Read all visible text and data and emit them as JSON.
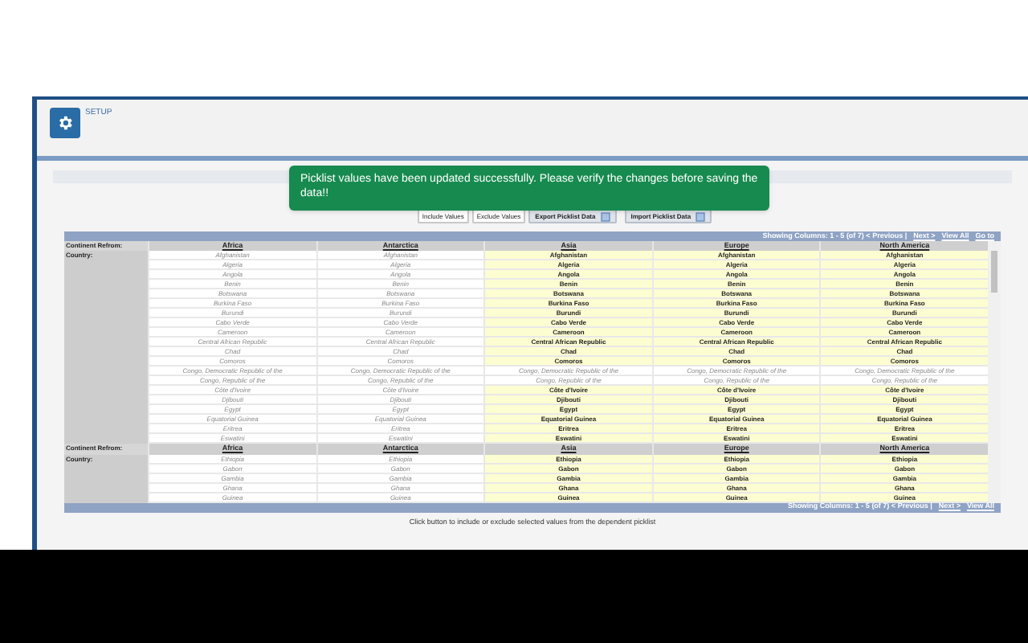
{
  "header": {
    "title": "SETUP"
  },
  "toast": {
    "message": "Picklist values have been updated successfully. Please verify the changes before saving the data!!"
  },
  "buttons": [
    {
      "label": "Include Values",
      "kind": "plain"
    },
    {
      "label": "Exclude Values",
      "kind": "plain"
    },
    {
      "label": "Export Picklist Data",
      "kind": "file"
    },
    {
      "label": "Import Picklist Data",
      "kind": "file"
    }
  ],
  "pager_top": {
    "text": "Showing Columns: 1 - 5 (of 7) < Previous |",
    "next": "Next >",
    "view_all": "View All",
    "go_to": "Go to"
  },
  "blocks": [
    {
      "label": "Continent Refrom:",
      "row_label": "Country:",
      "columns": [
        "Africa",
        "Antarctica",
        "Asia",
        "Europe",
        "North America"
      ],
      "rows": [
        {
          "values": [
            "Afghanistan",
            "Afghanistan",
            "Afghanistan",
            "Afghanistan",
            "Afghanistan"
          ],
          "included": [
            false,
            false,
            true,
            true,
            true
          ]
        },
        {
          "values": [
            "Algeria",
            "Algeria",
            "Algeria",
            "Algeria",
            "Algeria"
          ],
          "included": [
            false,
            false,
            true,
            true,
            true
          ]
        },
        {
          "values": [
            "Angola",
            "Angola",
            "Angola",
            "Angola",
            "Angola"
          ],
          "included": [
            false,
            false,
            true,
            true,
            true
          ]
        },
        {
          "values": [
            "Benin",
            "Benin",
            "Benin",
            "Benin",
            "Benin"
          ],
          "included": [
            false,
            false,
            true,
            true,
            true
          ]
        },
        {
          "values": [
            "Botswana",
            "Botswana",
            "Botswana",
            "Botswana",
            "Botswana"
          ],
          "included": [
            false,
            false,
            true,
            true,
            true
          ]
        },
        {
          "values": [
            "Burkina Faso",
            "Burkina Faso",
            "Burkina Faso",
            "Burkina Faso",
            "Burkina Faso"
          ],
          "included": [
            false,
            false,
            true,
            true,
            true
          ]
        },
        {
          "values": [
            "Burundi",
            "Burundi",
            "Burundi",
            "Burundi",
            "Burundi"
          ],
          "included": [
            false,
            false,
            true,
            true,
            true
          ]
        },
        {
          "values": [
            "Cabo Verde",
            "Cabo Verde",
            "Cabo Verde",
            "Cabo Verde",
            "Cabo Verde"
          ],
          "included": [
            false,
            false,
            true,
            true,
            true
          ]
        },
        {
          "values": [
            "Cameroon",
            "Cameroon",
            "Cameroon",
            "Cameroon",
            "Cameroon"
          ],
          "included": [
            false,
            false,
            true,
            true,
            true
          ]
        },
        {
          "values": [
            "Central African Republic",
            "Central African Republic",
            "Central African Republic",
            "Central African Republic",
            "Central African Republic"
          ],
          "included": [
            false,
            false,
            true,
            true,
            true
          ]
        },
        {
          "values": [
            "Chad",
            "Chad",
            "Chad",
            "Chad",
            "Chad"
          ],
          "included": [
            false,
            false,
            true,
            true,
            true
          ]
        },
        {
          "values": [
            "Comoros",
            "Comoros",
            "Comoros",
            "Comoros",
            "Comoros"
          ],
          "included": [
            false,
            false,
            true,
            true,
            true
          ]
        },
        {
          "values": [
            "Congo, Democratic Republic of the",
            "Congo, Democratic Republic of the",
            "Congo, Democratic Republic of the",
            "Congo, Democratic Republic of the",
            "Congo, Democratic Republic of the"
          ],
          "included": [
            false,
            false,
            false,
            false,
            false
          ]
        },
        {
          "values": [
            "Congo, Republic of the",
            "Congo, Republic of the",
            "Congo, Republic of the",
            "Congo, Republic of the",
            "Congo, Republic of the"
          ],
          "included": [
            false,
            false,
            false,
            false,
            false
          ]
        },
        {
          "values": [
            "Côte d'Ivoire",
            "Côte d'Ivoire",
            "Côte d'Ivoire",
            "Côte d'Ivoire",
            "Côte d'Ivoire"
          ],
          "included": [
            false,
            false,
            true,
            true,
            true
          ]
        },
        {
          "values": [
            "Djibouti",
            "Djibouti",
            "Djibouti",
            "Djibouti",
            "Djibouti"
          ],
          "included": [
            false,
            false,
            true,
            true,
            true
          ]
        },
        {
          "values": [
            "Egypt",
            "Egypt",
            "Egypt",
            "Egypt",
            "Egypt"
          ],
          "included": [
            false,
            false,
            true,
            true,
            true
          ]
        },
        {
          "values": [
            "Equatorial Guinea",
            "Equatorial Guinea",
            "Equatorial Guinea",
            "Equatorial Guinea",
            "Equatorial Guinea"
          ],
          "included": [
            false,
            false,
            true,
            true,
            true
          ]
        },
        {
          "values": [
            "Eritrea",
            "Eritrea",
            "Eritrea",
            "Eritrea",
            "Eritrea"
          ],
          "included": [
            false,
            false,
            true,
            true,
            true
          ]
        },
        {
          "values": [
            "Eswatini",
            "Eswatini",
            "Eswatini",
            "Eswatini",
            "Eswatini"
          ],
          "included": [
            false,
            false,
            true,
            true,
            true
          ]
        }
      ]
    },
    {
      "label": "Continent Refrom:",
      "row_label": "Country:",
      "columns": [
        "Africa",
        "Antarctica",
        "Asia",
        "Europe",
        "North America"
      ],
      "rows": [
        {
          "values": [
            "Ethiopia",
            "Ethiopia",
            "Ethiopia",
            "Ethiopia",
            "Ethiopia"
          ],
          "included": [
            false,
            false,
            true,
            true,
            true
          ]
        },
        {
          "values": [
            "Gabon",
            "Gabon",
            "Gabon",
            "Gabon",
            "Gabon"
          ],
          "included": [
            false,
            false,
            true,
            true,
            true
          ]
        },
        {
          "values": [
            "Gambia",
            "Gambia",
            "Gambia",
            "Gambia",
            "Gambia"
          ],
          "included": [
            false,
            false,
            true,
            true,
            true
          ]
        },
        {
          "values": [
            "Ghana",
            "Ghana",
            "Ghana",
            "Ghana",
            "Ghana"
          ],
          "included": [
            false,
            false,
            true,
            true,
            true
          ]
        },
        {
          "values": [
            "Guinea",
            "Guinea",
            "Guinea",
            "Guinea",
            "Guinea"
          ],
          "included": [
            false,
            false,
            true,
            true,
            true
          ]
        }
      ]
    }
  ],
  "pager_bottom": {
    "text": "Showing Columns: 1 - 5 (of 7) < Previous |",
    "next": "Next >",
    "view_all": "View All"
  },
  "footer": {
    "text": "Click button to include or exclude selected values from the dependent picklist"
  }
}
